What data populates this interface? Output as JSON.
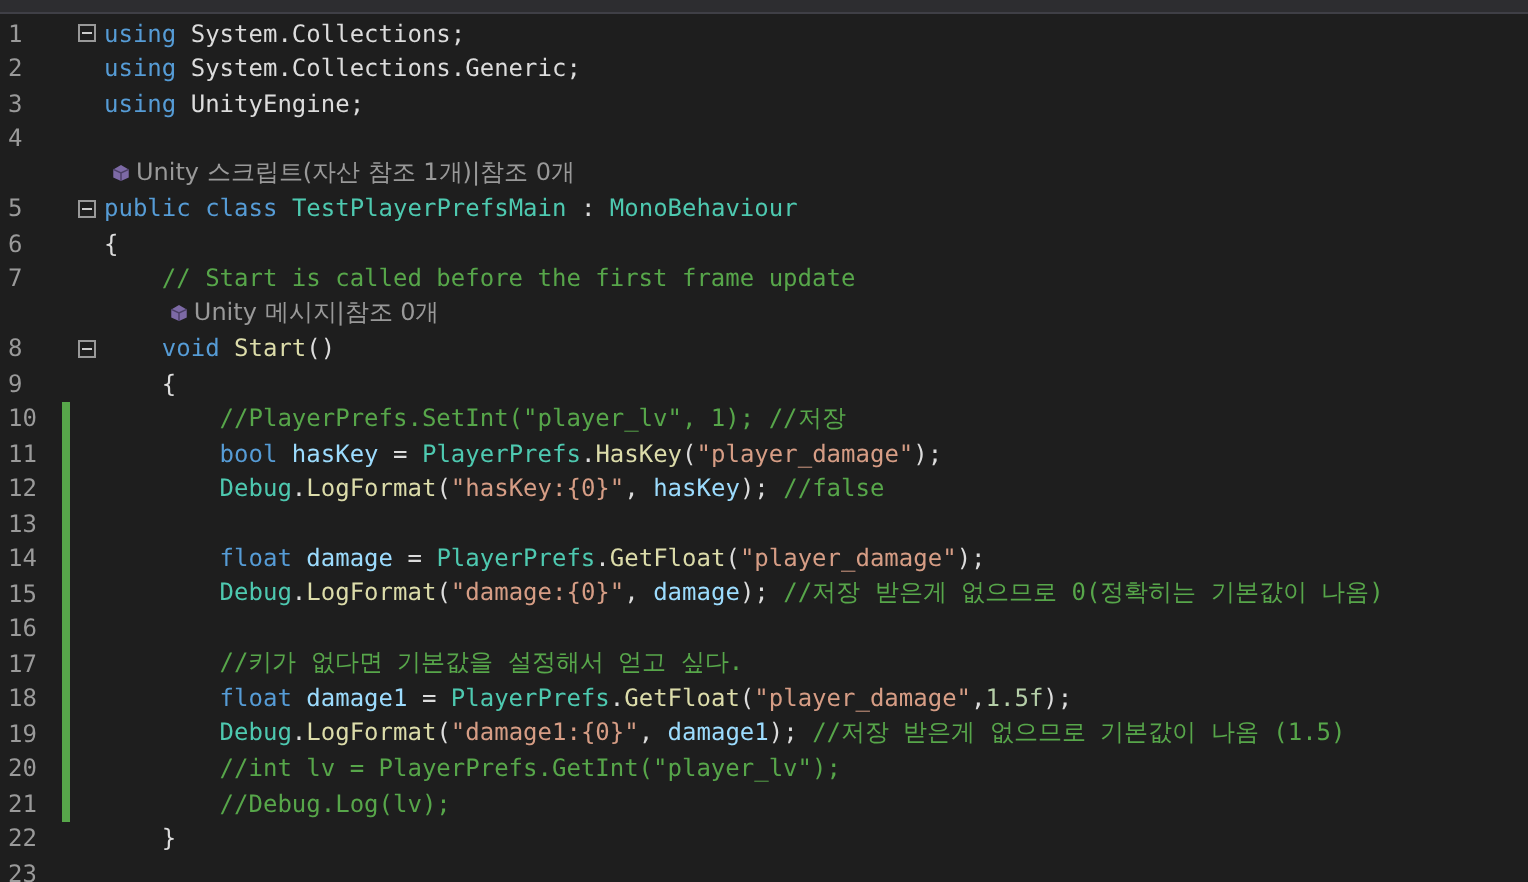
{
  "editor": {
    "lines": [
      {
        "number": "1",
        "changed": false,
        "fold": true,
        "tokens": [
          {
            "kind": "keyword",
            "text": "using"
          },
          {
            "kind": "plain",
            "text": " System.Collections;"
          }
        ]
      },
      {
        "number": "2",
        "changed": false,
        "fold": false,
        "tokens": [
          {
            "kind": "keyword",
            "text": "using"
          },
          {
            "kind": "plain",
            "text": " System.Collections.Generic;"
          }
        ]
      },
      {
        "number": "3",
        "changed": false,
        "fold": false,
        "tokens": [
          {
            "kind": "keyword",
            "text": "using"
          },
          {
            "kind": "plain",
            "text": " UnityEngine;"
          }
        ]
      },
      {
        "number": "4",
        "changed": false,
        "fold": false
      },
      {
        "number": "5",
        "changed": false,
        "fold": true,
        "lens": "Unity 스크립트(자산 참조 1개)|참조 0개",
        "tokens": [
          {
            "kind": "keyword",
            "text": "public"
          },
          {
            "kind": "keyword",
            "text": " class"
          },
          {
            "kind": "type",
            "text": " TestPlayerPrefsMain"
          },
          {
            "kind": "plain",
            "text": " : "
          },
          {
            "kind": "type",
            "text": "MonoBehaviour"
          }
        ]
      },
      {
        "number": "6",
        "changed": false,
        "fold": false,
        "tokens": [
          {
            "kind": "plain",
            "text": "{"
          }
        ]
      },
      {
        "number": "7",
        "changed": false,
        "fold": false,
        "tokens": [
          {
            "kind": "comment",
            "text": "    // Start is called before the first frame update"
          }
        ]
      },
      {
        "number": "8",
        "changed": false,
        "fold": true,
        "lens": "Unity 메시지|참조 0개",
        "tokens": [
          {
            "kind": "keyword",
            "text": "    void"
          },
          {
            "kind": "method",
            "text": " Start"
          },
          {
            "kind": "plain",
            "text": "()"
          }
        ]
      },
      {
        "number": "9",
        "changed": false,
        "fold": false,
        "tokens": [
          {
            "kind": "plain",
            "text": "    {"
          }
        ]
      },
      {
        "number": "10",
        "changed": true,
        "fold": false,
        "tokens": [
          {
            "kind": "comment",
            "text": "        //PlayerPrefs.SetInt(\"player_lv\", 1); //저장"
          }
        ]
      },
      {
        "number": "11",
        "changed": true,
        "fold": false,
        "tokens": [
          {
            "kind": "keyword",
            "text": "        bool"
          },
          {
            "kind": "variable",
            "text": " hasKey"
          },
          {
            "kind": "plain",
            "text": " = "
          },
          {
            "kind": "type",
            "text": "PlayerPrefs"
          },
          {
            "kind": "plain",
            "text": "."
          },
          {
            "kind": "method",
            "text": "HasKey"
          },
          {
            "kind": "plain",
            "text": "("
          },
          {
            "kind": "string",
            "text": "\"player_damage\""
          },
          {
            "kind": "plain",
            "text": ");"
          }
        ]
      },
      {
        "number": "12",
        "changed": true,
        "fold": false,
        "tokens": [
          {
            "kind": "type",
            "text": "        Debug"
          },
          {
            "kind": "plain",
            "text": "."
          },
          {
            "kind": "method",
            "text": "LogFormat"
          },
          {
            "kind": "plain",
            "text": "("
          },
          {
            "kind": "string",
            "text": "\"hasKey:{0}\""
          },
          {
            "kind": "plain",
            "text": ", "
          },
          {
            "kind": "variable",
            "text": "hasKey"
          },
          {
            "kind": "plain",
            "text": "); "
          },
          {
            "kind": "comment",
            "text": "//false"
          }
        ]
      },
      {
        "number": "13",
        "changed": true,
        "fold": false
      },
      {
        "number": "14",
        "changed": true,
        "fold": false,
        "tokens": [
          {
            "kind": "keyword",
            "text": "        float"
          },
          {
            "kind": "variable",
            "text": " damage"
          },
          {
            "kind": "plain",
            "text": " = "
          },
          {
            "kind": "type",
            "text": "PlayerPrefs"
          },
          {
            "kind": "plain",
            "text": "."
          },
          {
            "kind": "method",
            "text": "GetFloat"
          },
          {
            "kind": "plain",
            "text": "("
          },
          {
            "kind": "string",
            "text": "\"player_damage\""
          },
          {
            "kind": "plain",
            "text": ");"
          }
        ]
      },
      {
        "number": "15",
        "changed": true,
        "fold": false,
        "tokens": [
          {
            "kind": "type",
            "text": "        Debug"
          },
          {
            "kind": "plain",
            "text": "."
          },
          {
            "kind": "method",
            "text": "LogFormat"
          },
          {
            "kind": "plain",
            "text": "("
          },
          {
            "kind": "string",
            "text": "\"damage:{0}\""
          },
          {
            "kind": "plain",
            "text": ", "
          },
          {
            "kind": "variable",
            "text": "damage"
          },
          {
            "kind": "plain",
            "text": "); "
          },
          {
            "kind": "comment",
            "text": "//저장 받은게 없으므로 0(정확히는 기본값이 나옴)"
          }
        ]
      },
      {
        "number": "16",
        "changed": true,
        "fold": false
      },
      {
        "number": "17",
        "changed": true,
        "fold": false,
        "tokens": [
          {
            "kind": "comment",
            "text": "        //키가 없다면 기본값을 설정해서 얻고 싶다."
          }
        ]
      },
      {
        "number": "18",
        "changed": true,
        "fold": false,
        "tokens": [
          {
            "kind": "keyword",
            "text": "        float"
          },
          {
            "kind": "variable",
            "text": " damage1"
          },
          {
            "kind": "plain",
            "text": " = "
          },
          {
            "kind": "type",
            "text": "PlayerPrefs"
          },
          {
            "kind": "plain",
            "text": "."
          },
          {
            "kind": "method",
            "text": "GetFloat"
          },
          {
            "kind": "plain",
            "text": "("
          },
          {
            "kind": "string",
            "text": "\"player_damage\""
          },
          {
            "kind": "plain",
            "text": ","
          },
          {
            "kind": "number",
            "text": "1.5f"
          },
          {
            "kind": "plain",
            "text": ");"
          }
        ]
      },
      {
        "number": "19",
        "changed": true,
        "fold": false,
        "tokens": [
          {
            "kind": "type",
            "text": "        Debug"
          },
          {
            "kind": "plain",
            "text": "."
          },
          {
            "kind": "method",
            "text": "LogFormat"
          },
          {
            "kind": "plain",
            "text": "("
          },
          {
            "kind": "string",
            "text": "\"damage1:{0}\""
          },
          {
            "kind": "plain",
            "text": ", "
          },
          {
            "kind": "variable",
            "text": "damage1"
          },
          {
            "kind": "plain",
            "text": "); "
          },
          {
            "kind": "comment",
            "text": "//저장 받은게 없으므로 기본값이 나옴 (1.5)"
          }
        ]
      },
      {
        "number": "20",
        "changed": true,
        "fold": false,
        "tokens": [
          {
            "kind": "comment",
            "text": "        //int lv = PlayerPrefs.GetInt(\"player_lv\");"
          }
        ]
      },
      {
        "number": "21",
        "changed": true,
        "fold": false,
        "tokens": [
          {
            "kind": "comment",
            "text": "        //Debug.Log(lv);"
          }
        ]
      },
      {
        "number": "22",
        "changed": false,
        "fold": false,
        "tokens": [
          {
            "kind": "plain",
            "text": "    }"
          }
        ]
      },
      {
        "number": "23",
        "changed": false,
        "fold": false
      }
    ]
  }
}
